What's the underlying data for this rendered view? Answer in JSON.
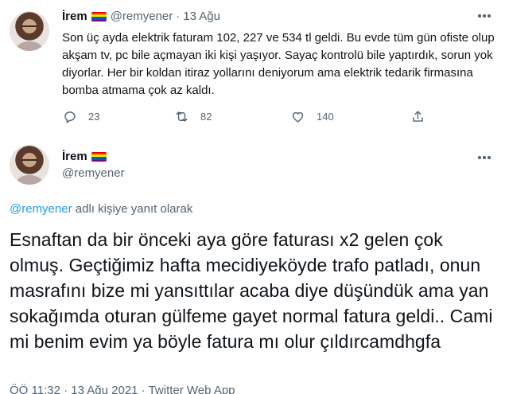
{
  "tweet1": {
    "name": "İrem",
    "handle": "@remyener",
    "separator": "·",
    "date": "13 Ağu",
    "text": "Son üç ayda elektrik faturam 102, 227 ve 534 tl geldi. Bu evde tüm gün ofiste olup akşam tv, pc bile açmayan iki kişi yaşıyor. Sayaç kontrolü bile yaptırdık, sorun yok diyorlar. Her bir koldan itiraz yollarını deniyorum ama elektrik tedarik firmasına bomba atmama çok az kaldı.",
    "actions": {
      "reply_count": "23",
      "retweet_count": "82",
      "like_count": "140"
    }
  },
  "tweet2": {
    "name": "İrem",
    "handle": "@remyener",
    "reply_mention": "@remyener",
    "reply_suffix": " adlı kişiye yanıt olarak",
    "text": "Esnaftan da bir önceki aya göre faturası x2 gelen çok olmuş. Geçtiğimiz hafta mecidiyeköyde trafo patladı, onun masrafını bize mi yansıttılar acaba diye düşündük ama yan sokağımda oturan gülfeme gayet normal fatura geldi.. Cami mi benim evim ya böyle fatura mı olur çıldırcamdhgfa",
    "meta": "ÖÖ 11:32 · 13 Ağu 2021 · Twitter Web App"
  },
  "icons": {
    "reply": "reply-icon",
    "retweet": "retweet-icon",
    "like": "heart-icon",
    "share": "share-icon",
    "more": "more-icon",
    "flag": "rainbow-flag-icon"
  },
  "colors": {
    "text": "#0f1419",
    "secondary": "#536471",
    "link": "#1d9bf0"
  }
}
